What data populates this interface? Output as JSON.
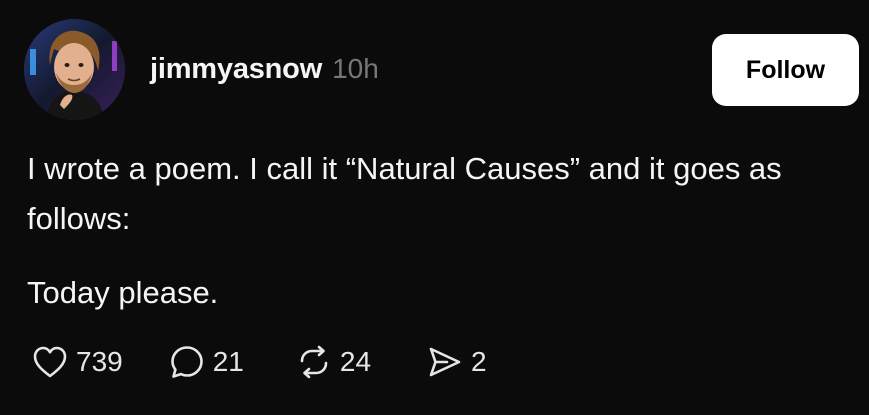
{
  "post": {
    "username": "jimmyasnow",
    "timestamp": "10h",
    "follow_label": "Follow",
    "paragraphs": [
      "I wrote a poem. I call it “Natural Causes” and it goes as follows:",
      "Today please."
    ],
    "actions": {
      "likes": "739",
      "replies": "21",
      "reposts": "24",
      "shares": "2"
    }
  },
  "icons": {
    "like": "heart-icon",
    "reply": "comment-bubble-icon",
    "repost": "repost-arrows-icon",
    "share": "send-paper-plane-icon"
  },
  "colors": {
    "background": "#0b0b0b",
    "text": "#f3f5f7",
    "muted": "#777777",
    "button_bg": "#ffffff",
    "button_text": "#000000"
  }
}
